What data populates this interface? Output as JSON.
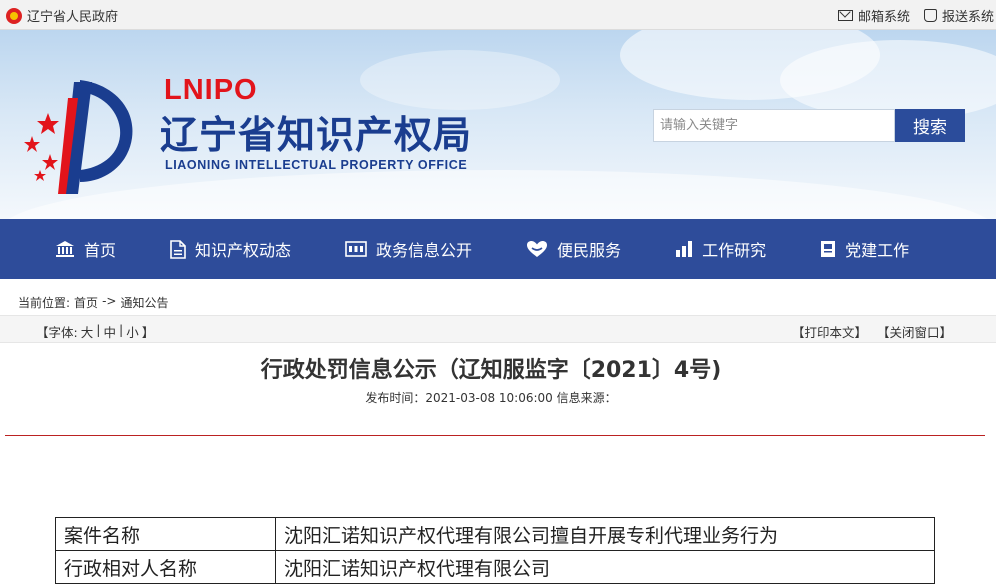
{
  "topbar": {
    "gov_link": "辽宁省人民政府",
    "mail_link": "邮箱系统",
    "submit_link": "报送系统"
  },
  "header": {
    "logo_abbr": "LNIPO",
    "site_name": "辽宁省知识产权局",
    "site_name_en": "LIAONING INTELLECTUAL PROPERTY OFFICE",
    "search_placeholder": "请输入关键字",
    "search_button": "搜索",
    "colors": {
      "brand_blue": "#2e4c9a",
      "logo_red": "#e2141b"
    }
  },
  "nav": [
    {
      "label": "首页",
      "icon": "bank-icon"
    },
    {
      "label": "知识产权动态",
      "icon": "document-icon"
    },
    {
      "label": "政务信息公开",
      "icon": "info-board-icon"
    },
    {
      "label": "便民服务",
      "icon": "heart-hands-icon"
    },
    {
      "label": "工作研究",
      "icon": "bar-chart-icon"
    },
    {
      "label": "党建工作",
      "icon": "flag-icon"
    }
  ],
  "breadcrumb": {
    "prefix": "当前位置:",
    "home": "首页",
    "sep": "->",
    "current": "通知公告"
  },
  "toolbar": {
    "font_label": "【字体:",
    "large": "大",
    "medium": "中",
    "small": "小",
    "font_end": "】",
    "bar1": "|",
    "bar2": "|",
    "print": "【打印本文】",
    "close": "【关闭窗口】"
  },
  "article": {
    "title": "行政处罚信息公示（辽知服监字〔2021〕4号)",
    "meta": "发布时间：2021-03-08 10:06:00 信息来源："
  },
  "table": {
    "rows": [
      {
        "key": "案件名称",
        "value": "沈阳汇诺知识产权代理有限公司擅自开展专利代理业务行为"
      },
      {
        "key": "行政相对人名称",
        "value": "沈阳汇诺知识产权代理有限公司"
      }
    ]
  }
}
